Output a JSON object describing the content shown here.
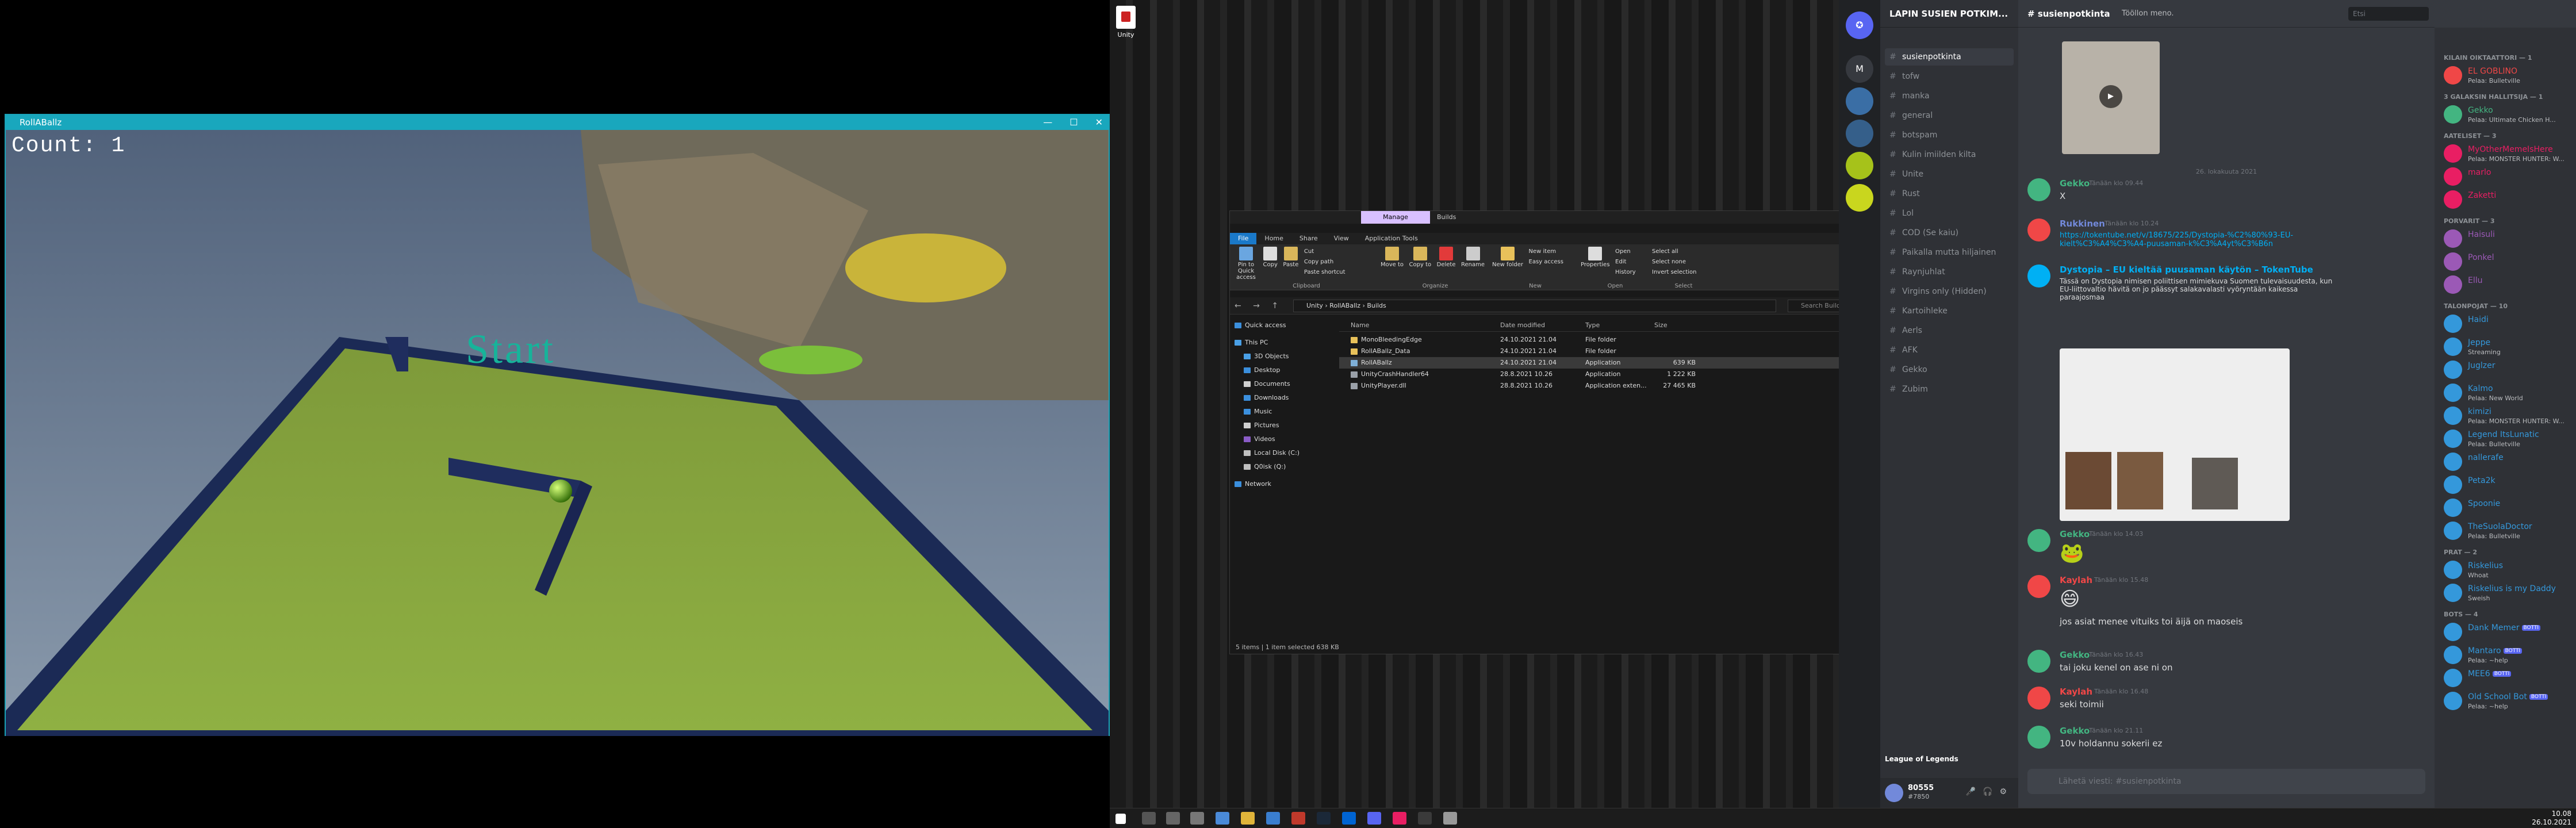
{
  "game": {
    "window_title": "RollABallz",
    "controls": [
      "—",
      "☐",
      "✕"
    ],
    "count_text": "Count: 1",
    "start_text": "Start"
  },
  "desktop": {
    "unity_icon_label": "Unity"
  },
  "explorer": {
    "manage_tab": "Manage",
    "title": "Builds",
    "window_buttons": [
      "—",
      "☐",
      "✕"
    ],
    "tabs": [
      "File",
      "Home",
      "Share",
      "View",
      "Application Tools"
    ],
    "ribbon": {
      "clipboard": {
        "label": "Clipboard",
        "pin": "Pin to Quick access",
        "copy": "Copy",
        "paste": "Paste",
        "cut": "Cut",
        "copy_path": "Copy path",
        "paste_shortcut": "Paste shortcut"
      },
      "organize": {
        "label": "Organize",
        "move_to": "Move to",
        "copy_to": "Copy to",
        "delete": "Delete",
        "rename": "Rename"
      },
      "new": {
        "label": "New",
        "new_folder": "New folder",
        "new_item": "New item",
        "easy_access": "Easy access"
      },
      "open": {
        "label": "Open",
        "properties": "Properties",
        "open": "Open",
        "edit": "Edit",
        "history": "History"
      },
      "select": {
        "label": "Select",
        "select_all": "Select all",
        "select_none": "Select none",
        "invert": "Invert selection"
      }
    },
    "nav_arrows": "← → ↑",
    "path": "Unity  ›  RollABallz  ›  Builds",
    "search_placeholder": "Search Builds",
    "sidebar": [
      {
        "label": "Quick access",
        "color": "#3b8fdd"
      },
      {
        "label": "This PC",
        "color": "#4aa0e6"
      },
      {
        "label": "3D Objects",
        "color": "#4aa0e6"
      },
      {
        "label": "Desktop",
        "color": "#3b8fdd"
      },
      {
        "label": "Documents",
        "color": "#cfcfcf"
      },
      {
        "label": "Downloads",
        "color": "#3b8fdd"
      },
      {
        "label": "Music",
        "color": "#3b8fdd"
      },
      {
        "label": "Pictures",
        "color": "#cfcfcf"
      },
      {
        "label": "Videos",
        "color": "#8a5cc7"
      },
      {
        "label": "Local Disk (C:)",
        "color": "#bfbfbf"
      },
      {
        "label": "Q0isk (Q:)",
        "color": "#bfbfbf"
      },
      {
        "label": "Network",
        "color": "#3b8fdd"
      }
    ],
    "columns": [
      "Name",
      "Date modified",
      "Type",
      "Size"
    ],
    "files": [
      {
        "name": "MonoBleedingEdge",
        "date": "24.10.2021 21.04",
        "type": "File folder",
        "size": "",
        "icon": "#e8c15a"
      },
      {
        "name": "RollABallz_Data",
        "date": "24.10.2021 21.04",
        "type": "File folder",
        "size": "",
        "icon": "#e8c15a"
      },
      {
        "name": "RollABallz",
        "date": "24.10.2021 21.04",
        "type": "Application",
        "size": "639 KB",
        "icon": "#7fb0d8"
      },
      {
        "name": "UnityCrashHandler64",
        "date": "28.8.2021 10.26",
        "type": "Application",
        "size": "1 222 KB",
        "icon": "#9aa0a8"
      },
      {
        "name": "UnityPlayer.dll",
        "date": "28.8.2021 10.26",
        "type": "Application exten...",
        "size": "27 465 KB",
        "icon": "#9aa0a8"
      }
    ],
    "selected_index": 2,
    "status": "5 items   |   1 item selected  638 KB"
  },
  "discord": {
    "guild_name": "LAPIN SUSIEN POTKIM...",
    "servers": [
      "M",
      "",
      "",
      "",
      "",
      ""
    ],
    "channels": [
      {
        "name": "susienpotkinta",
        "active": true
      },
      {
        "name": "tofw",
        "active": false
      },
      {
        "name": "manka",
        "active": false
      },
      {
        "name": "general",
        "active": false
      },
      {
        "name": "botspam",
        "active": false
      },
      {
        "name": "Kulin imiilden kilta",
        "active": false
      },
      {
        "name": "Unite",
        "active": false
      },
      {
        "name": "Rust",
        "active": false
      },
      {
        "name": "Lol",
        "active": false
      },
      {
        "name": "COD (Se kaiu)",
        "active": false
      },
      {
        "name": "Paikalla mutta hiljainen",
        "active": false
      },
      {
        "name": "Raynjuhlat",
        "active": false
      },
      {
        "name": "Virgins only (Hidden)",
        "active": false
      },
      {
        "name": "Kartoihleke",
        "active": false
      },
      {
        "name": "Aerls",
        "active": false
      },
      {
        "name": "AFK",
        "active": false
      },
      {
        "name": "Gekko",
        "active": false
      },
      {
        "name": "Zubim",
        "active": false
      }
    ],
    "voice_status": "League of Legends",
    "user_name": "80555",
    "user_tag": "#7850",
    "channel_title": "susienpotkinta",
    "channel_topic": "Tööllon meno.",
    "search_placeholder": "Etsi",
    "date_divider": "26. lokakuuta 2021",
    "messages": [
      {
        "author": "Gekko",
        "time": "Tänään klo 09.44",
        "text": "X",
        "color": "#43b581"
      },
      {
        "author": "Rukkinen",
        "time": "Tänään klo 10.24",
        "text": "https://tokentube.net/v/18675/225/Dystopia-%C2%80%93-EU-kielt%C3%A4%C3%A4-puusaman-k%C3%A4yt%C3%B6n",
        "color": "#7289da"
      },
      {
        "author": "Dystopia – EU kieltää puusaman käytön – TokenTube",
        "time": "",
        "text": "Tässä on Dystopia nimisen poliittisen mimiekuva Suomen tulevaisuudesta, kun EU-liittovaltio hävitä on jo päässyt salakavalasti vyöryntään kaikessa paraajosmaa",
        "color": "#00b0f4"
      },
      {
        "author": "Gekko",
        "time": "Tänään klo 14.03",
        "text": "🐸",
        "color": "#43b581"
      },
      {
        "author": "Kaylah",
        "time": "Tänään klo 15.48",
        "text": "😄",
        "color": "#f04747"
      },
      {
        "author": "",
        "time": "",
        "text": "jos asiat menee vituiks toi äijä on maoseis",
        "color": "#dcddde"
      },
      {
        "author": "Gekko",
        "time": "Tänään klo 16.43",
        "text": "tai joku kenel on ase ni on",
        "color": "#43b581"
      },
      {
        "author": "Kaylah",
        "time": "Tänään klo 16.48",
        "text": "seki toimii",
        "color": "#f04747"
      },
      {
        "author": "Gekko",
        "time": "Tänään klo 21.11",
        "text": "10v holdannu sokerii ez",
        "color": "#43b581"
      }
    ],
    "input_placeholder": "Lähetä viesti: #susienpotkinta",
    "member_groups": [
      {
        "title": "KILAIN OIKTAATTORI — 1",
        "members": [
          {
            "name": "EL GOBLINO",
            "status": "Pelaa: Bulletville",
            "color": "#f04747"
          }
        ]
      },
      {
        "title": "3 GALAKSIN HALLITSIJA — 1",
        "members": [
          {
            "name": "Gekko",
            "status": "Pelaa: Ultimate Chicken H...",
            "color": "#43b581"
          }
        ]
      },
      {
        "title": "AATELISET — 3",
        "members": [
          {
            "name": "MyOtherMemeIsHere",
            "status": "Pelaa: MONSTER HUNTER: W...",
            "color": "#e91e63"
          },
          {
            "name": "marlo",
            "status": "",
            "color": "#e91e63"
          },
          {
            "name": "Zaketti",
            "status": "",
            "color": "#e91e63"
          }
        ]
      },
      {
        "title": "PORVARIT — 3",
        "members": [
          {
            "name": "Haisuli",
            "status": "",
            "color": "#9b59b6"
          },
          {
            "name": "Ponkel",
            "status": "",
            "color": "#9b59b6"
          },
          {
            "name": "Ellu",
            "status": "",
            "color": "#9b59b6"
          }
        ]
      },
      {
        "title": "TALONPOJAT — 10",
        "members": [
          {
            "name": "Haidi",
            "status": "",
            "color": "#3498db"
          },
          {
            "name": "Jeppe",
            "status": "Streaming",
            "color": "#3498db"
          },
          {
            "name": "Juglzer",
            "status": "",
            "color": "#3498db"
          },
          {
            "name": "Kalmo",
            "status": "Pelaa: New World",
            "color": "#3498db"
          },
          {
            "name": "kimizi",
            "status": "Pelaa: MONSTER HUNTER: W...",
            "color": "#3498db"
          },
          {
            "name": "Legend ItsLunatic",
            "status": "Pelaa: Bulletville",
            "color": "#3498db"
          },
          {
            "name": "nallerafe",
            "status": "",
            "color": "#3498db"
          },
          {
            "name": "Peta2k",
            "status": "",
            "color": "#3498db"
          },
          {
            "name": "Spoonie",
            "status": "",
            "color": "#3498db"
          },
          {
            "name": "TheSuolaDoctor",
            "status": "Pelaa: Bulletville",
            "color": "#3498db"
          }
        ]
      },
      {
        "title": "PRAT — 2",
        "members": [
          {
            "name": "Riskelius",
            "status": "Whoat",
            "color": "#3498db"
          },
          {
            "name": "Riskelius is my Daddy",
            "status": "Sweish",
            "color": "#3498db"
          }
        ]
      },
      {
        "title": "BOTS — 4",
        "members": [
          {
            "name": "Dank Memer",
            "status": "",
            "color": "#3498db",
            "bot": "BOTTI"
          },
          {
            "name": "Mantaro",
            "status": "Pelaa: ~help",
            "color": "#3498db",
            "bot": "BOTTI"
          },
          {
            "name": "MEE6",
            "status": "",
            "color": "#3498db",
            "bot": "BOTTI"
          },
          {
            "name": "Old School Bot",
            "status": "Pelaa: ~help",
            "color": "#3498db",
            "bot": "BOTTI"
          }
        ]
      }
    ]
  },
  "taskbar": {
    "time": "10.08",
    "date": "26.10.2021"
  }
}
